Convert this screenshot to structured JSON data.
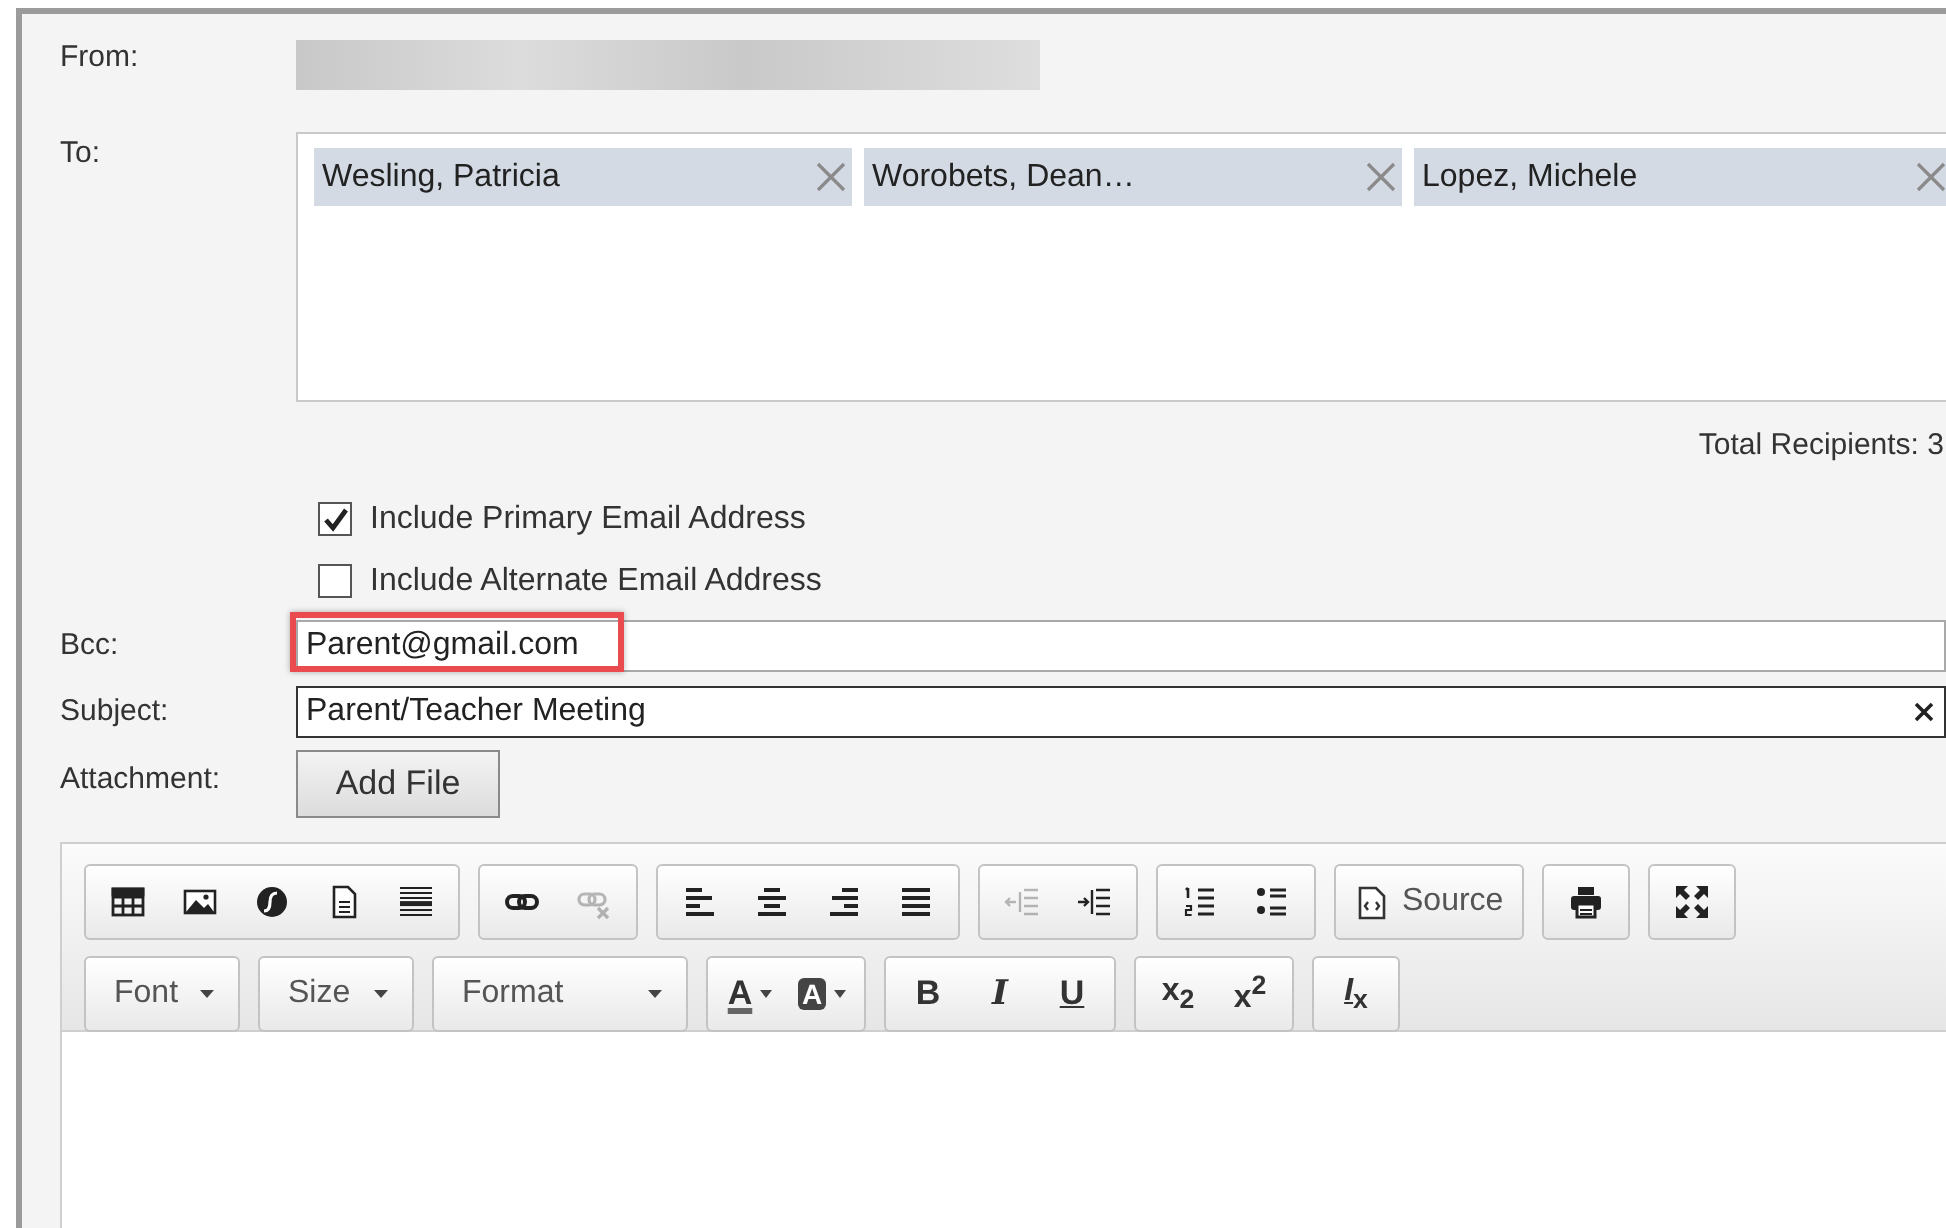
{
  "from": {
    "label": "From:"
  },
  "to": {
    "label": "To:",
    "recipients": [
      {
        "name": "Wesling, Patricia"
      },
      {
        "name": "Worobets, Dean…"
      },
      {
        "name": "Lopez, Michele"
      }
    ]
  },
  "total_recipients": "Total Recipients: 3",
  "options": [
    {
      "label": "Include Primary Email Address",
      "checked": true
    },
    {
      "label": "Include Alternate Email Address",
      "checked": false
    }
  ],
  "bcc": {
    "label": "Bcc:",
    "value": "Parent@gmail.com",
    "highlighted": true
  },
  "subject": {
    "label": "Subject:",
    "value": "Parent/Teacher Meeting"
  },
  "attachment": {
    "label": "Attachment:",
    "button": "Add File"
  },
  "editor": {
    "toolbar": [
      [
        {
          "buttons": [
            {
              "kind": "table",
              "disabled": false
            },
            {
              "kind": "image",
              "disabled": false
            },
            {
              "kind": "flash",
              "disabled": false
            },
            {
              "kind": "page",
              "disabled": false
            },
            {
              "kind": "rule",
              "disabled": false
            }
          ]
        },
        {
          "buttons": [
            {
              "kind": "link",
              "disabled": false
            },
            {
              "kind": "unlink",
              "disabled": true
            }
          ]
        },
        {
          "buttons": [
            {
              "kind": "alignleft",
              "disabled": false
            },
            {
              "kind": "aligncenter",
              "disabled": false
            },
            {
              "kind": "alignright",
              "disabled": false
            },
            {
              "kind": "justify",
              "disabled": false
            }
          ]
        },
        {
          "buttons": [
            {
              "kind": "outdent",
              "disabled": true
            },
            {
              "kind": "indent",
              "disabled": false
            }
          ]
        },
        {
          "buttons": [
            {
              "kind": "numbered",
              "disabled": false
            },
            {
              "kind": "bulleted",
              "disabled": false
            }
          ]
        },
        {
          "buttons": [
            {
              "kind": "source",
              "label": "Source",
              "disabled": false
            }
          ]
        },
        {
          "buttons": [
            {
              "kind": "print",
              "disabled": false
            }
          ]
        },
        {
          "buttons": [
            {
              "kind": "maximize",
              "disabled": false
            }
          ]
        }
      ],
      [
        {
          "buttons": [
            {
              "kind": "dropdown",
              "label": "Font",
              "disabled": false
            }
          ]
        },
        {
          "buttons": [
            {
              "kind": "dropdown",
              "label": "Size",
              "disabled": false
            }
          ]
        },
        {
          "buttons": [
            {
              "kind": "dropdown",
              "label": "Format",
              "disabled": false
            }
          ]
        },
        {
          "buttons": [
            {
              "kind": "textcolor",
              "label": "A",
              "disabled": false
            },
            {
              "kind": "bgcolor",
              "label": "A",
              "disabled": false
            }
          ]
        },
        {
          "buttons": [
            {
              "kind": "bold",
              "label": "B",
              "disabled": false
            },
            {
              "kind": "italic",
              "label": "I",
              "disabled": false
            },
            {
              "kind": "underline",
              "label": "U",
              "disabled": false
            }
          ]
        },
        {
          "buttons": [
            {
              "kind": "script",
              "label": "x$_{2}$",
              "disabled": false
            },
            {
              "kind": "script",
              "label": "x$^{2}$",
              "disabled": false
            }
          ]
        },
        {
          "buttons": [
            {
              "kind": "clearformat",
              "label": "*I*$_{x}$",
              "disabled": false
            }
          ]
        }
      ]
    ]
  }
}
